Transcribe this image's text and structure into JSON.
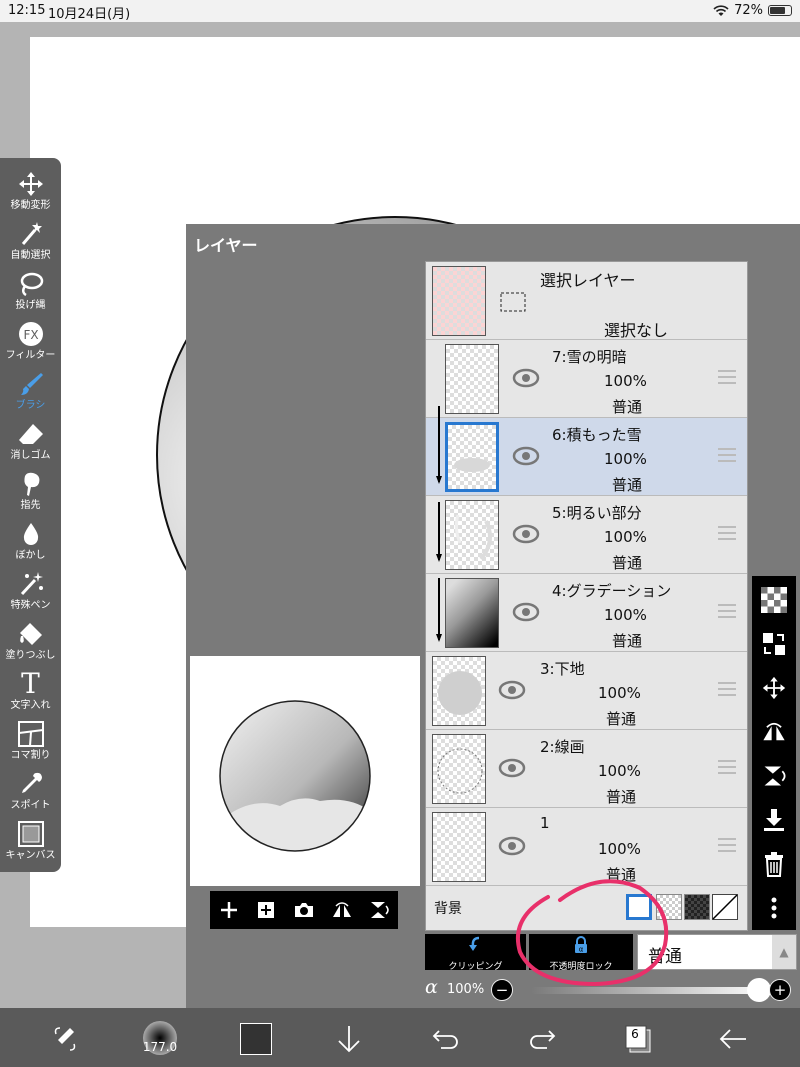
{
  "status_bar": {
    "time": "12:15",
    "date": "10月24日(月)",
    "battery": "72%"
  },
  "toolbar": {
    "items": [
      {
        "label": "移動変形",
        "icon": "move-icon"
      },
      {
        "label": "自動選択",
        "icon": "magic-wand-icon"
      },
      {
        "label": "投げ縄",
        "icon": "lasso-icon"
      },
      {
        "label": "フィルター",
        "icon": "fx-icon",
        "badge": "FX"
      },
      {
        "label": "ブラシ",
        "icon": "brush-icon",
        "active": true
      },
      {
        "label": "消しゴム",
        "icon": "eraser-icon"
      },
      {
        "label": "指先",
        "icon": "finger-icon"
      },
      {
        "label": "ぼかし",
        "icon": "blur-drop-icon"
      },
      {
        "label": "特殊ペン",
        "icon": "special-pen-icon"
      },
      {
        "label": "塗りつぶし",
        "icon": "fill-bucket-icon"
      },
      {
        "label": "文字入れ",
        "icon": "text-icon",
        "glyph": "T"
      },
      {
        "label": "コマ割り",
        "icon": "frame-divide-icon"
      },
      {
        "label": "スポイト",
        "icon": "eyedropper-icon"
      },
      {
        "label": "キャンバス",
        "icon": "canvas-icon"
      }
    ]
  },
  "layer_window": {
    "title": "レイヤー",
    "selection_layer": {
      "title": "選択レイヤー",
      "status": "選択なし"
    },
    "layers": [
      {
        "name": "7:雪の明暗",
        "opacity": "100%",
        "blend": "普通",
        "clipped": false
      },
      {
        "name": "6:積もった雪",
        "opacity": "100%",
        "blend": "普通",
        "clipped": true,
        "selected": true
      },
      {
        "name": "5:明るい部分",
        "opacity": "100%",
        "blend": "普通",
        "clipped": true
      },
      {
        "name": "4:グラデーション",
        "opacity": "100%",
        "blend": "普通",
        "clipped": true
      },
      {
        "name": "3:下地",
        "opacity": "100%",
        "blend": "普通",
        "clipped": false
      },
      {
        "name": "2:線画",
        "opacity": "100%",
        "blend": "普通",
        "clipped": false
      },
      {
        "name": "1",
        "opacity": "100%",
        "blend": "普通",
        "clipped": false
      }
    ],
    "background_label": "背景",
    "clipping_label": "クリッピング",
    "opacity_lock_label": "不透明度ロック",
    "blend_mode": "普通",
    "alpha_symbol": "α",
    "alpha_value": "100%",
    "alpha_level": 1.0
  },
  "bottom_bar": {
    "brush_size": "177.0",
    "layer_count": "6"
  },
  "colors": {
    "accent": "#2878d0",
    "annotation": "#e8306a",
    "toolbar": "#5e5e5e"
  }
}
